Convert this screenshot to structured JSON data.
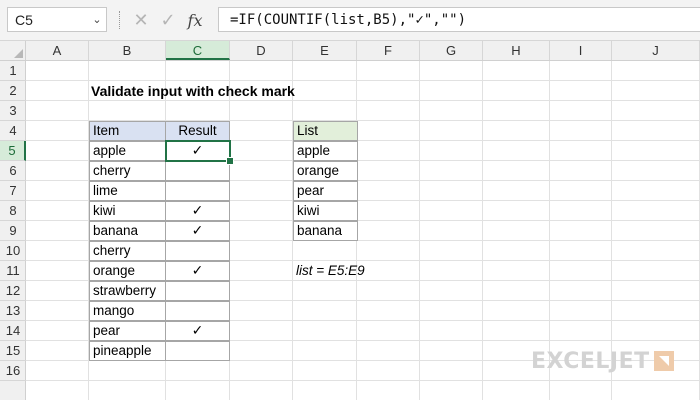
{
  "formula_bar": {
    "name_box": "C5",
    "name_box_arrow": "⌄",
    "more_icon": "⋮",
    "cancel_icon": "✕",
    "enter_icon": "✓",
    "fx_label": "fx",
    "formula": "=IF(COUNTIF(list,B5),\"✓\",\"\")"
  },
  "columns": [
    "A",
    "B",
    "C",
    "D",
    "E",
    "F",
    "G",
    "H",
    "I",
    "J"
  ],
  "active_column": "C",
  "rows": [
    "1",
    "2",
    "3",
    "4",
    "5",
    "6",
    "7",
    "8",
    "9",
    "10",
    "11",
    "12",
    "13",
    "14",
    "15",
    "16"
  ],
  "active_row": "5",
  "sheet": {
    "title": "Validate input with check mark",
    "main_table": {
      "headers": [
        "Item",
        "Result"
      ],
      "rows": [
        {
          "item": "apple",
          "result": "✓"
        },
        {
          "item": "cherry",
          "result": ""
        },
        {
          "item": "lime",
          "result": ""
        },
        {
          "item": "kiwi",
          "result": "✓"
        },
        {
          "item": "banana",
          "result": "✓"
        },
        {
          "item": "cherry",
          "result": ""
        },
        {
          "item": "orange",
          "result": "✓"
        },
        {
          "item": "strawberry",
          "result": ""
        },
        {
          "item": "mango",
          "result": ""
        },
        {
          "item": "pear",
          "result": "✓"
        },
        {
          "item": "pineapple",
          "result": ""
        }
      ]
    },
    "list_table": {
      "header": "List",
      "items": [
        "apple",
        "orange",
        "pear",
        "kiwi",
        "banana"
      ]
    },
    "note": "list = E5:E9"
  },
  "colors": {
    "accent": "#217346",
    "header_blue": "#d9e1f2",
    "header_green": "#e2efda"
  },
  "logo": {
    "text": "EXCELJET"
  }
}
